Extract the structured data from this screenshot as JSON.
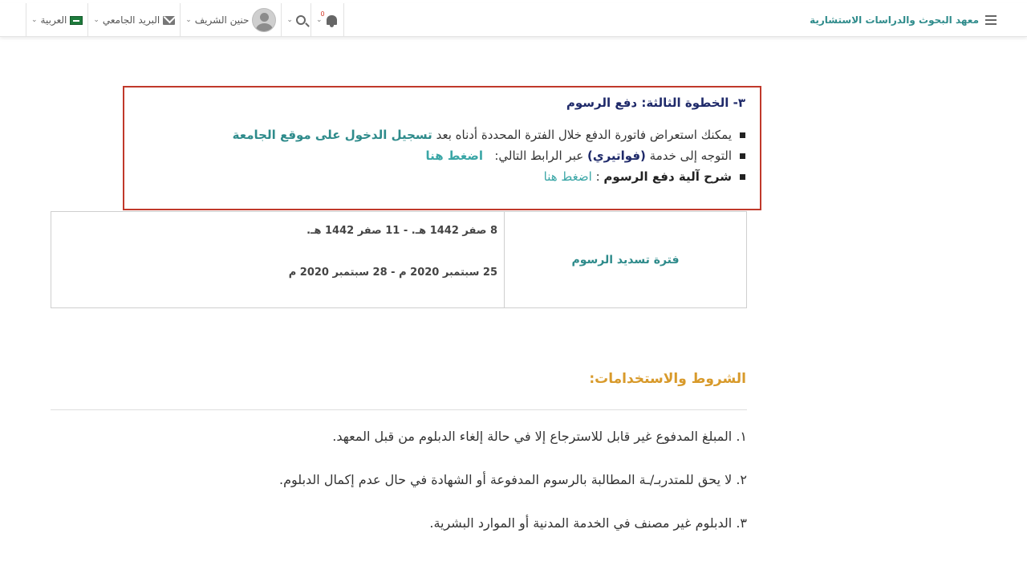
{
  "header": {
    "brand_title": "معهد البحوث والدراسات الاستشارية",
    "language_label": "العربية",
    "mail_label": "البريد الجامعي",
    "user_name": "حنين الشريف",
    "notification_count": "0"
  },
  "step": {
    "title": "٣- الخطوة الثالثة: دفع الرسوم",
    "item1_text": "يمكنك استعراض فاتورة الدفع خلال الفترة المحددة أدناه بعد",
    "item1_bold": "تسجيل الدخول على موقع الجامعة",
    "item2_prefix": "التوجه إلى خدمة",
    "item2_service": "(فواتيري)",
    "item2_middle": "عبر الرابط التالي:",
    "item2_link": "اضغط هنا",
    "item3_bold": "شرح آلية دفع الرسوم",
    "item3_sep": ":",
    "item3_link": "اضغط هنا"
  },
  "fee_table": {
    "label": "فترة تسديد الرسوم",
    "hijri_range": "8 صفر 1442 هـ.  -  11 صفر 1442 هـ.",
    "gregorian_range": "25 سبتمبر 2020 م  -  28 سبتمبر 2020 م"
  },
  "terms": {
    "title": "الشروط والاستخدامات:",
    "items": [
      "١. المبلغ المدفوع غير قابل للاسترجاع إلا في حالة إلغاء الدبلوم من قبل المعهد.",
      "٢. لا يحق للمتدربـ/ـة المطالبة بالرسوم المدفوعة أو الشهادة في حال عدم إكمال الدبلوم.",
      "٣. الدبلوم غير مصنف في الخدمة المدنية أو الموارد البشرية."
    ]
  },
  "colors": {
    "brand_teal": "#2e8b8b",
    "title_navy": "#1f2a6a",
    "box_border_red": "#c0392b",
    "terms_gold": "#d89a2b"
  }
}
